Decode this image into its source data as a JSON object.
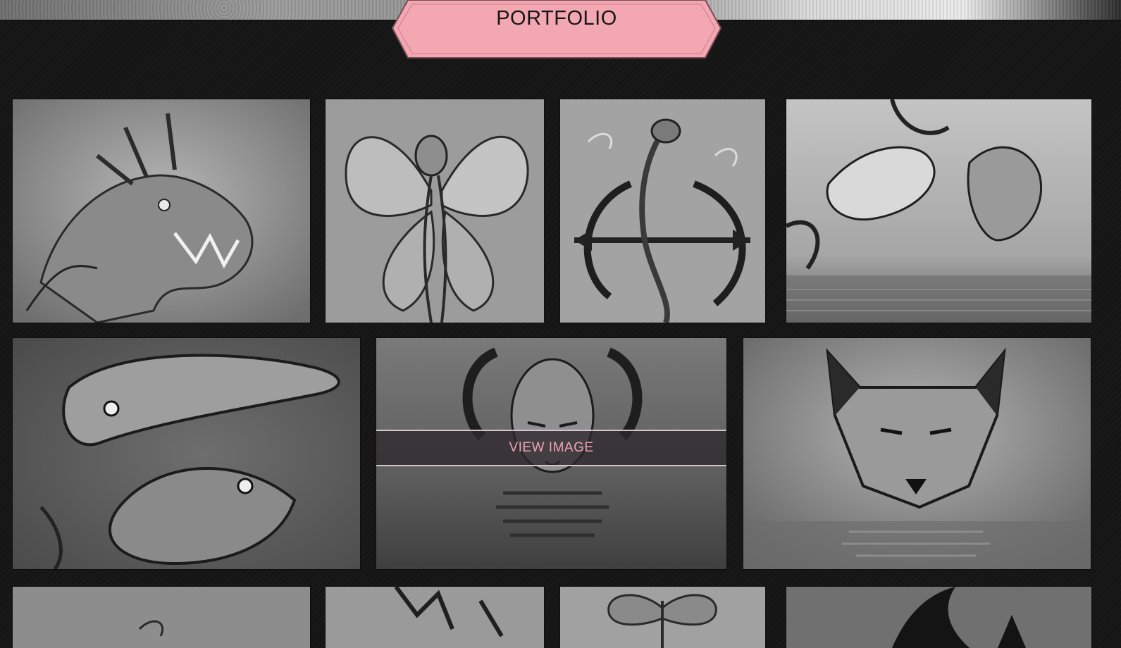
{
  "section": {
    "title": "PORTFOLIO",
    "accent_color": "#f2a7b2"
  },
  "gallery": {
    "items": [
      {
        "subject": "dragon"
      },
      {
        "subject": "fairy"
      },
      {
        "subject": "pisces-mermaid"
      },
      {
        "subject": "koi-fish-pair"
      },
      {
        "subject": "koi-fish-yin-yang"
      },
      {
        "subject": "bald-face-reflection",
        "hover_label": "VIEW IMAGE"
      },
      {
        "subject": "wolf"
      },
      {
        "subject": "partial-tattoo-1"
      },
      {
        "subject": "partial-tattoo-2"
      },
      {
        "subject": "butterfly"
      },
      {
        "subject": "tribal-swirl"
      }
    ]
  }
}
